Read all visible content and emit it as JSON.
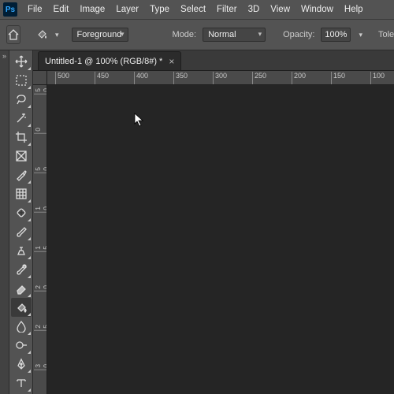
{
  "logo": "Ps",
  "menu": [
    "File",
    "Edit",
    "Image",
    "Layer",
    "Type",
    "Select",
    "Filter",
    "3D",
    "View",
    "Window",
    "Help"
  ],
  "options": {
    "foreground_label": "Foreground",
    "mode_label": "Mode:",
    "mode_value": "Normal",
    "opacity_label": "Opacity:",
    "opacity_value": "100%",
    "tolerance_label": "Toler"
  },
  "gutter_arrows": "»",
  "doc": {
    "tab_label": "Untitled-1 @ 100% (RGB/8#) *",
    "close": "×"
  },
  "hruler": [
    "500",
    "450",
    "400",
    "350",
    "300",
    "250",
    "200",
    "150",
    "100"
  ],
  "vruler_groups": [
    [
      "5",
      "0"
    ],
    [
      "0"
    ],
    [
      "5",
      "0"
    ],
    [
      "1",
      "0",
      "0"
    ],
    [
      "1",
      "5",
      "0"
    ],
    [
      "2",
      "0",
      "0"
    ],
    [
      "2",
      "5",
      "0"
    ],
    [
      "3",
      "0",
      "0"
    ]
  ],
  "tools": [
    "move",
    "marquee",
    "lasso",
    "wand",
    "crop",
    "frame",
    "eyedropper",
    "grid",
    "healing",
    "brush",
    "stamp",
    "history",
    "eraser",
    "bucket",
    "blur",
    "dodge",
    "pen",
    "type"
  ]
}
